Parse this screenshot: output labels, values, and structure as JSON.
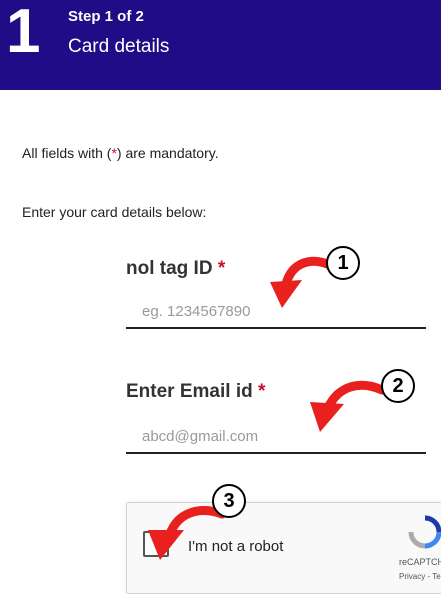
{
  "header": {
    "step_number": "1",
    "step_label": "Step 1 of 2",
    "title": "Card details"
  },
  "form": {
    "mandatory_note_prefix": "All fields with (",
    "mandatory_note_star": "*",
    "mandatory_note_suffix": ") are mandatory.",
    "instructions": "Enter your card details below:",
    "nol_tag": {
      "label": "nol tag ID",
      "required_mark": "*",
      "placeholder": "eg. 1234567890"
    },
    "email": {
      "label": "Enter Email id",
      "required_mark": "*",
      "placeholder": "abcd@gmail.com"
    },
    "captcha": {
      "label": "I'm not a robot",
      "brand": "reCAPTCHA",
      "links": "Privacy - Terms"
    }
  },
  "annotations": [
    "1",
    "2",
    "3"
  ],
  "colors": {
    "header_bg": "#1f0c86",
    "required": "#c8102e",
    "arrow": "#e8201e"
  }
}
